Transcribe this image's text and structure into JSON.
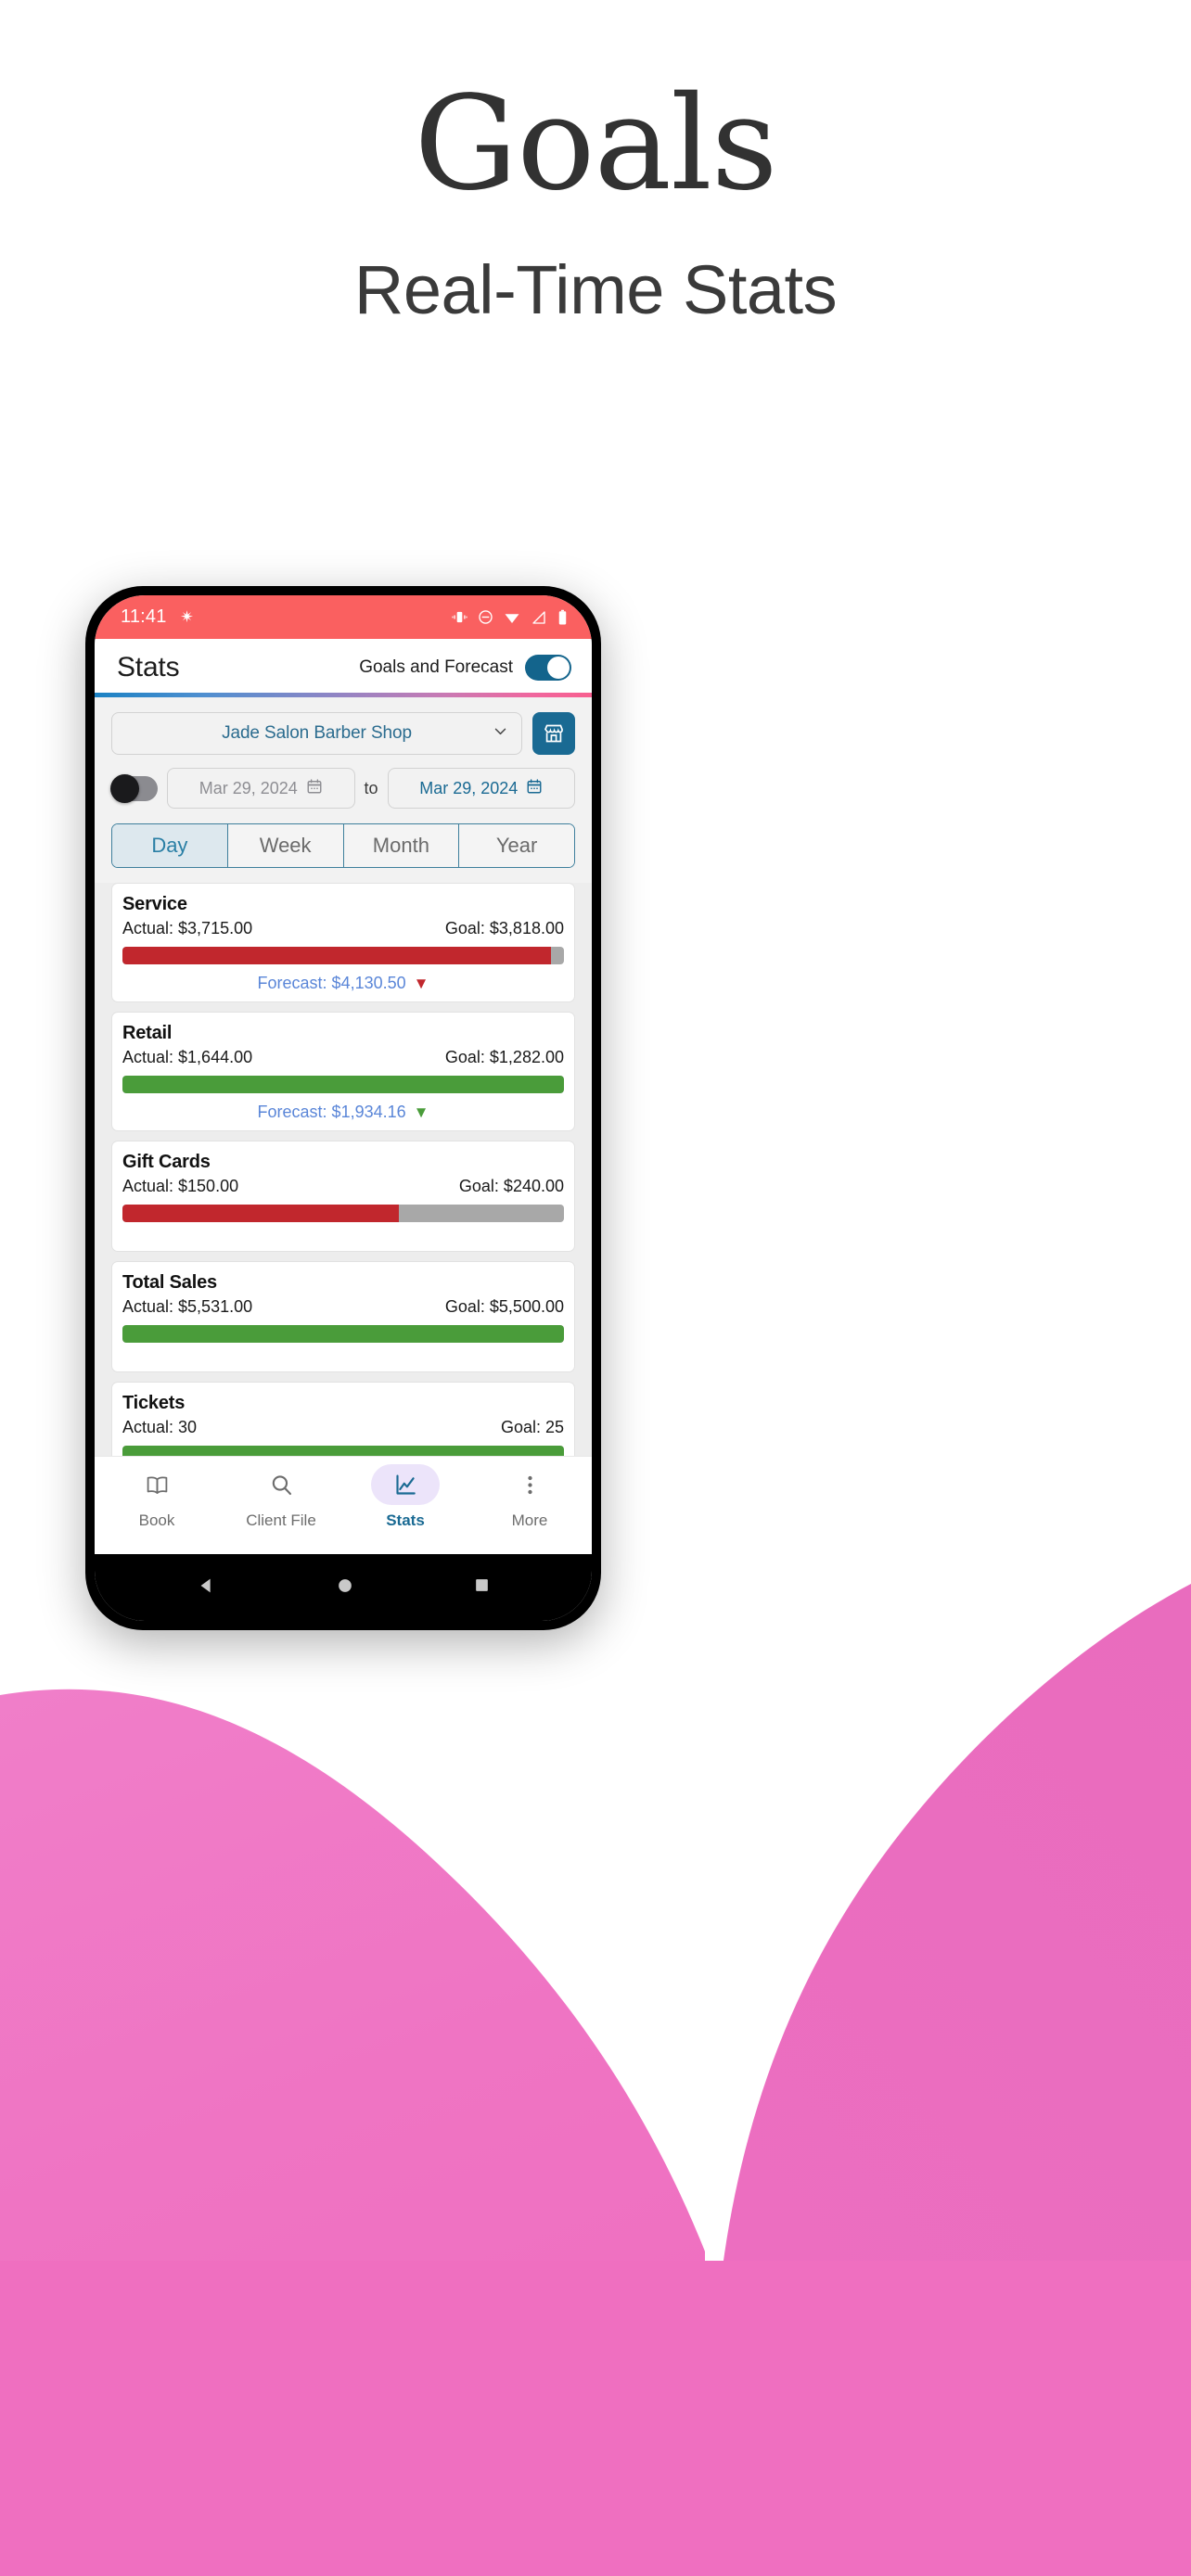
{
  "promo": {
    "title": "Goals",
    "subtitle": "Real-Time Stats"
  },
  "status_bar": {
    "time": "11:41",
    "left_icons": [
      "brightness-star-icon"
    ],
    "right_icons": [
      "vibrate-icon",
      "do-not-disturb-icon",
      "wifi-icon",
      "signal-icon",
      "battery-icon"
    ]
  },
  "app_header": {
    "title": "Stats",
    "toggle_label": "Goals and Forecast",
    "toggle_on": true,
    "accent": "#13648c"
  },
  "controls": {
    "salon_name": "Jade Salon  Barber Shop",
    "salon_chevron": "chevron-down-icon",
    "store_button_icon": "storefront-icon",
    "range_toggle_on": false,
    "date_from": "Mar 29, 2024",
    "date_to_label": "to",
    "date_to": "Mar 29, 2024",
    "calendar_icon": "calendar-icon",
    "periods": [
      {
        "label": "Day",
        "active": true
      },
      {
        "label": "Week",
        "active": false
      },
      {
        "label": "Month",
        "active": false
      },
      {
        "label": "Year",
        "active": false
      }
    ]
  },
  "goals": [
    {
      "name": "Service",
      "actual_label": "Actual: $3,715.00",
      "goal_label": "Goal: $3,818.00",
      "percent": 97,
      "bar_color": "#c1272d",
      "forecast_label": "Forecast: $4,130.50",
      "forecast_arrow": "▼",
      "forecast_arrow_color": "#c1272d"
    },
    {
      "name": "Retail",
      "actual_label": "Actual: $1,644.00",
      "goal_label": "Goal: $1,282.00",
      "percent": 100,
      "bar_color": "#4a9c3a",
      "forecast_label": "Forecast: $1,934.16",
      "forecast_arrow": "▼",
      "forecast_arrow_color": "#4a9c3a"
    },
    {
      "name": "Gift Cards",
      "actual_label": "Actual: $150.00",
      "goal_label": "Goal: $240.00",
      "percent": 62.5,
      "bar_color": "#c1272d",
      "forecast_label": "",
      "forecast_arrow": "",
      "forecast_arrow_color": ""
    },
    {
      "name": "Total Sales",
      "actual_label": "Actual: $5,531.00",
      "goal_label": "Goal: $5,500.00",
      "percent": 100,
      "bar_color": "#4a9c3a",
      "forecast_label": "",
      "forecast_arrow": "",
      "forecast_arrow_color": ""
    },
    {
      "name": "Tickets",
      "actual_label": "Actual: 30",
      "goal_label": "Goal: 25",
      "percent": 100,
      "bar_color": "#4a9c3a",
      "forecast_label": "",
      "forecast_arrow": "",
      "forecast_arrow_color": ""
    }
  ],
  "bottom_nav": [
    {
      "label": "Book",
      "icon": "book-icon",
      "active": false
    },
    {
      "label": "Client File",
      "icon": "search-icon",
      "active": false
    },
    {
      "label": "Stats",
      "icon": "line-chart-icon",
      "active": true
    },
    {
      "label": "More",
      "icon": "more-vertical-icon",
      "active": false
    }
  ],
  "system_nav": [
    "back-triangle-icon",
    "home-circle-icon",
    "recents-square-icon"
  ]
}
